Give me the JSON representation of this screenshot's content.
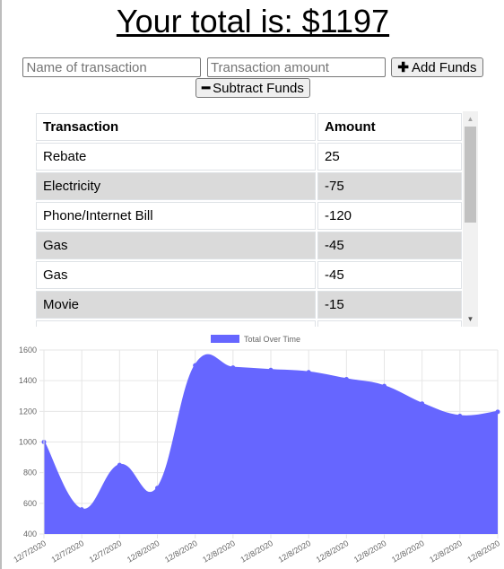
{
  "header": {
    "total_text": "Your total is: $1197"
  },
  "form": {
    "name_placeholder": "Name of transaction",
    "amount_placeholder": "Transaction amount",
    "add_label": "Add Funds",
    "add_icon": "plus-icon",
    "subtract_label": "Subtract Funds",
    "subtract_icon": "minus-icon"
  },
  "table": {
    "headers": [
      "Transaction",
      "Amount"
    ],
    "rows": [
      {
        "name": "Rebate",
        "amount": "25"
      },
      {
        "name": "Electricity",
        "amount": "-75"
      },
      {
        "name": "Phone/Internet Bill",
        "amount": "-120"
      },
      {
        "name": "Gas",
        "amount": "-45"
      },
      {
        "name": "Gas",
        "amount": "-45"
      },
      {
        "name": "Movie",
        "amount": "-15"
      }
    ]
  },
  "chart_data": {
    "type": "area",
    "series": [
      {
        "name": "Total Over Time",
        "color": "#6666ff",
        "values": [
          1000,
          560,
          850,
          700,
          1500,
          1485,
          1470,
          1455,
          1410,
          1365,
          1250,
          1170,
          1197
        ]
      }
    ],
    "x": [
      "12/7/2020",
      "12/7/2020",
      "12/7/2020",
      "12/8/2020",
      "12/8/2020",
      "12/8/2020",
      "12/8/2020",
      "12/8/2020",
      "12/8/2020",
      "12/8/2020",
      "12/8/2020",
      "12/8/2020",
      "12/8/2020"
    ],
    "ylim": [
      400,
      1600
    ],
    "yticks": [
      400,
      600,
      800,
      1000,
      1200,
      1400,
      1600
    ],
    "grid": true,
    "legend": "top-center"
  }
}
